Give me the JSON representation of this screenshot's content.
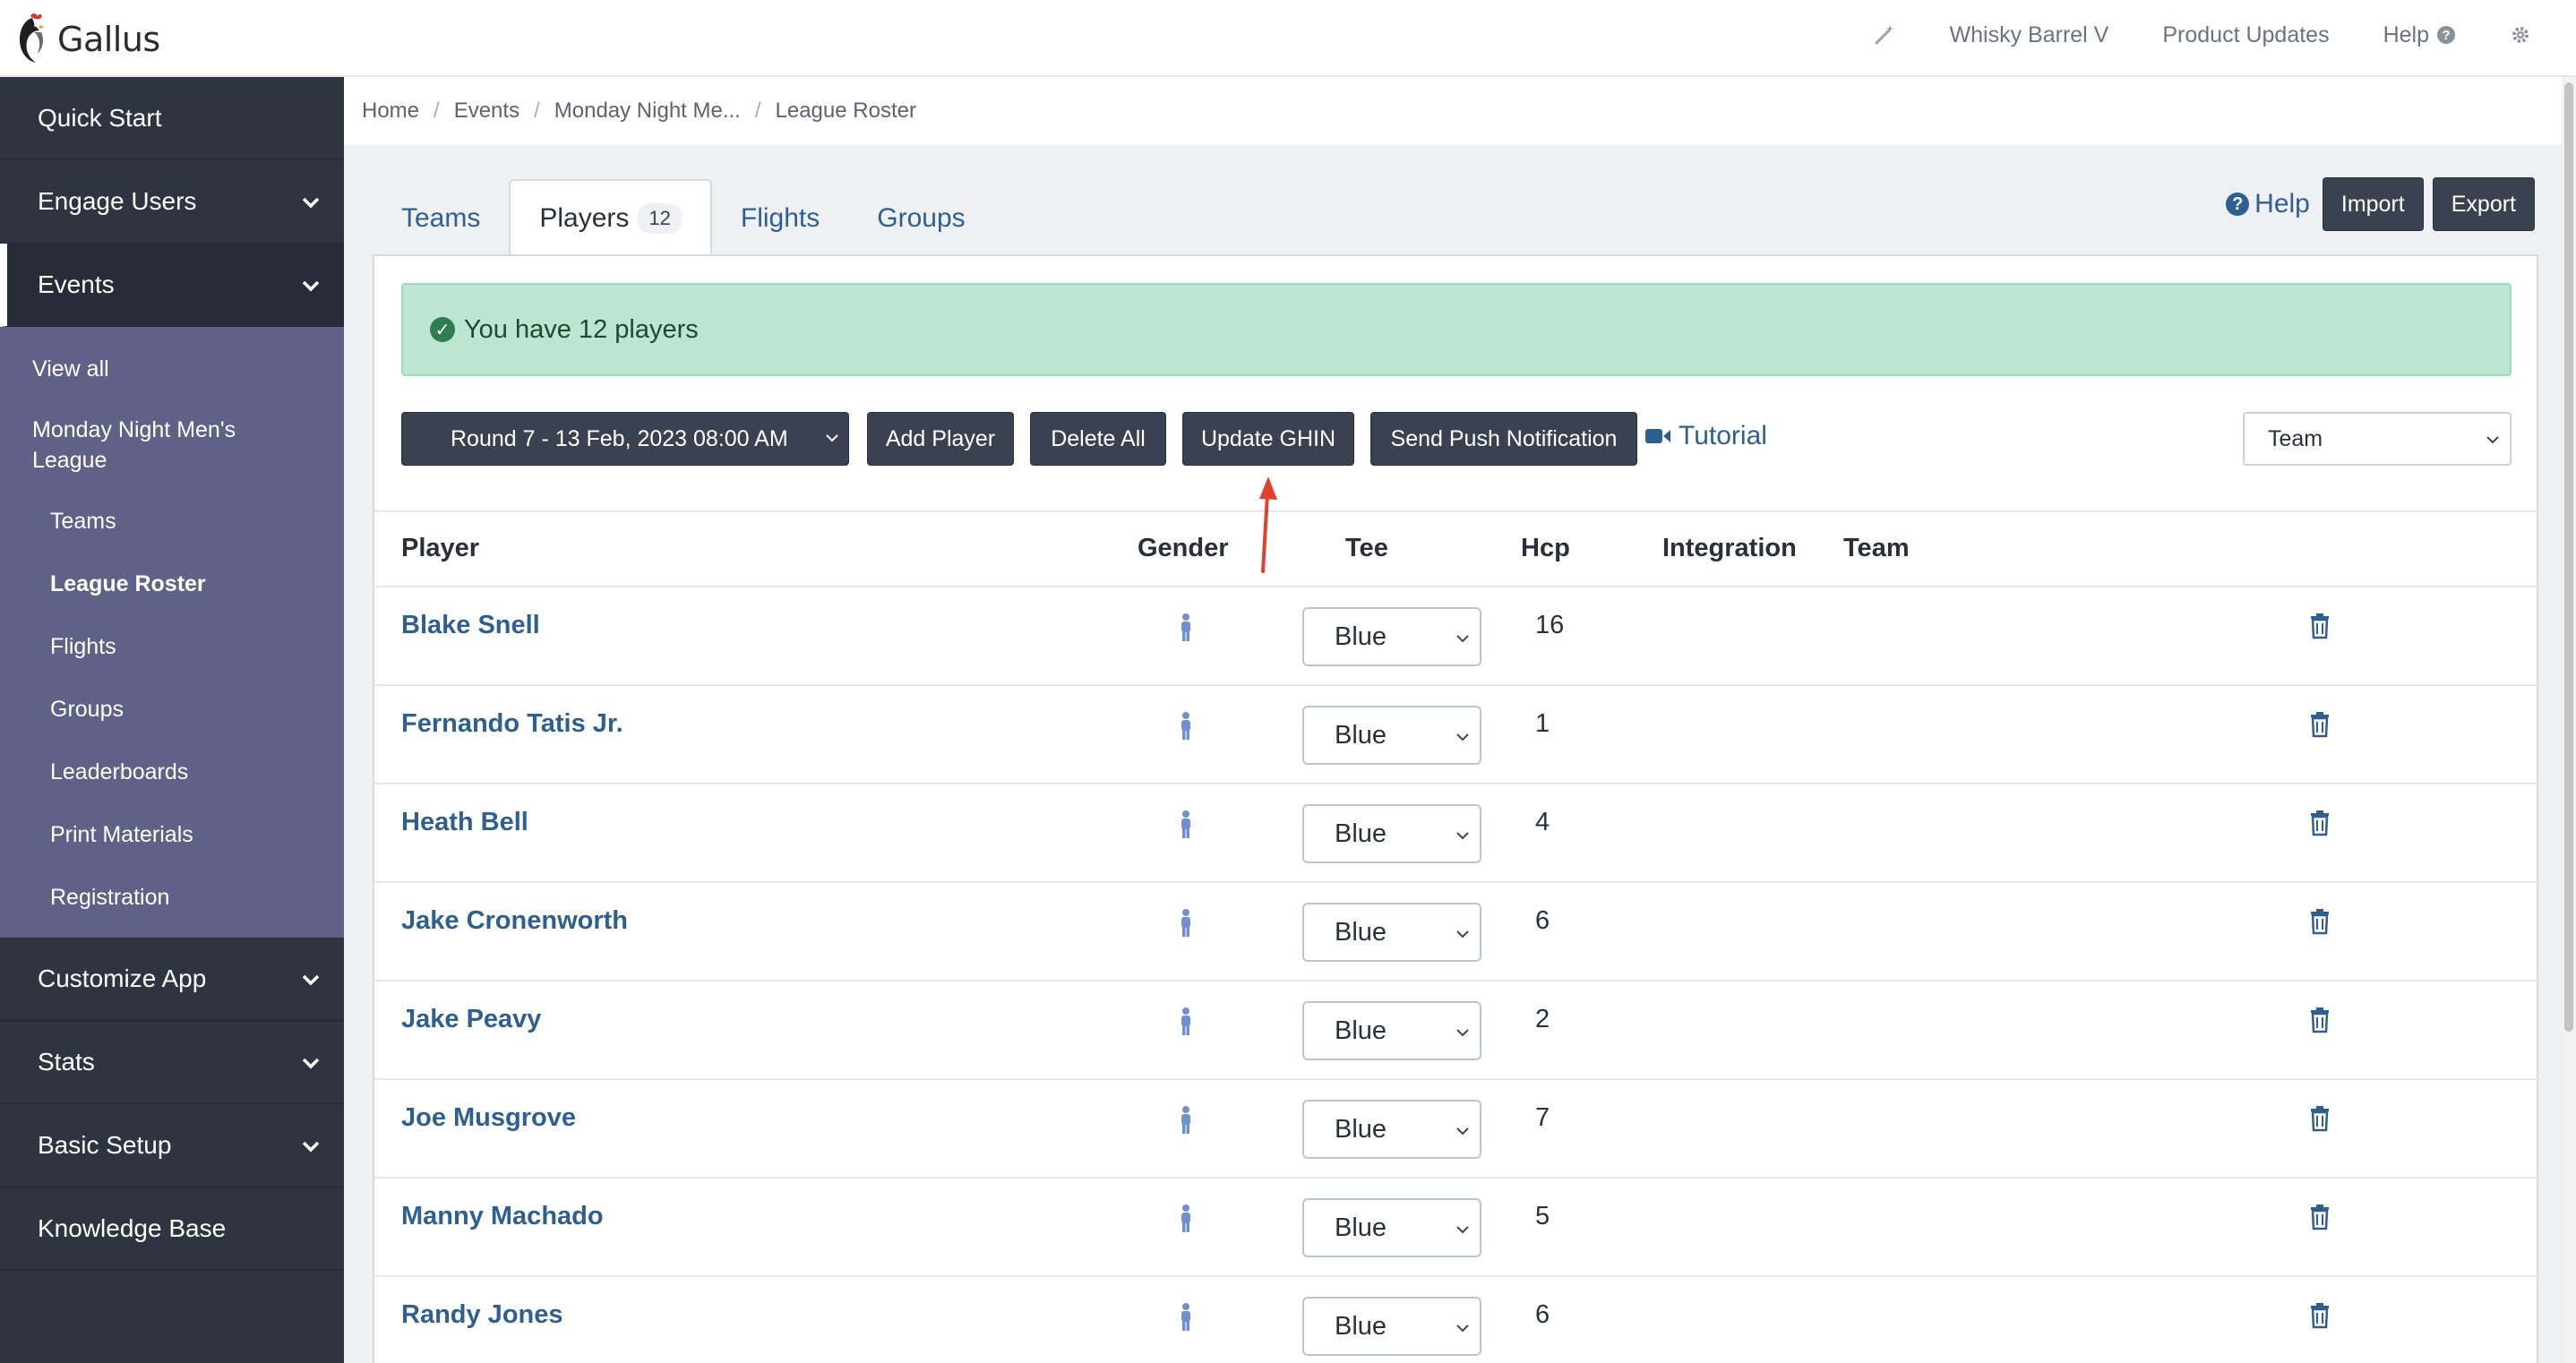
{
  "app": {
    "name": "Gallus"
  },
  "top_nav": {
    "wand_icon": "magic-wand-icon",
    "account": "Whisky Barrel V",
    "updates": "Product Updates",
    "help": "Help",
    "help_icon": "question-circle-icon",
    "settings_icon": "gear-icon"
  },
  "sidebar": {
    "quick_start": "Quick Start",
    "engage_users": "Engage Users",
    "events": "Events",
    "events_sub": {
      "view_all": "View all",
      "league": "Monday Night Men's League",
      "teams": "Teams",
      "league_roster": "League Roster",
      "flights": "Flights",
      "groups": "Groups",
      "leaderboards": "Leaderboards",
      "print_materials": "Print Materials",
      "registration": "Registration"
    },
    "customize_app": "Customize App",
    "stats": "Stats",
    "basic_setup": "Basic Setup",
    "knowledge_base": "Knowledge Base"
  },
  "breadcrumb": [
    "Home",
    "Events",
    "Monday Night Me...",
    "League Roster"
  ],
  "tabs": {
    "teams": "Teams",
    "players": "Players",
    "players_count": "12",
    "flights": "Flights",
    "groups": "Groups"
  },
  "actions": {
    "help": "Help",
    "import": "Import",
    "export": "Export"
  },
  "alert": {
    "message": "You have 12 players"
  },
  "toolbar": {
    "round_select": "Round 7 - 13 Feb, 2023 08:00 AM",
    "add_player": "Add Player",
    "delete_all": "Delete All",
    "update_ghin": "Update GHIN",
    "send_push": "Send Push Notification",
    "tutorial": "Tutorial",
    "team_select": "Team"
  },
  "table": {
    "headers": {
      "player": "Player",
      "gender": "Gender",
      "tee": "Tee",
      "hcp": "Hcp",
      "integration": "Integration",
      "team": "Team"
    },
    "rows": [
      {
        "player": "Blake Snell",
        "tee": "Blue",
        "hcp": "16"
      },
      {
        "player": "Fernando Tatis Jr.",
        "tee": "Blue",
        "hcp": "1"
      },
      {
        "player": "Heath Bell",
        "tee": "Blue",
        "hcp": "4"
      },
      {
        "player": "Jake Cronenworth",
        "tee": "Blue",
        "hcp": "6"
      },
      {
        "player": "Jake Peavy",
        "tee": "Blue",
        "hcp": "2"
      },
      {
        "player": "Joe Musgrove",
        "tee": "Blue",
        "hcp": "7"
      },
      {
        "player": "Manny Machado",
        "tee": "Blue",
        "hcp": "5"
      },
      {
        "player": "Randy Jones",
        "tee": "Blue",
        "hcp": "6"
      }
    ]
  },
  "colors": {
    "sidebar_bg": "#2f3441",
    "submenu_bg": "#5f6186",
    "link": "#2f5f8f",
    "success_bg": "#bde6d2",
    "annotation_arrow": "#e2402c"
  }
}
